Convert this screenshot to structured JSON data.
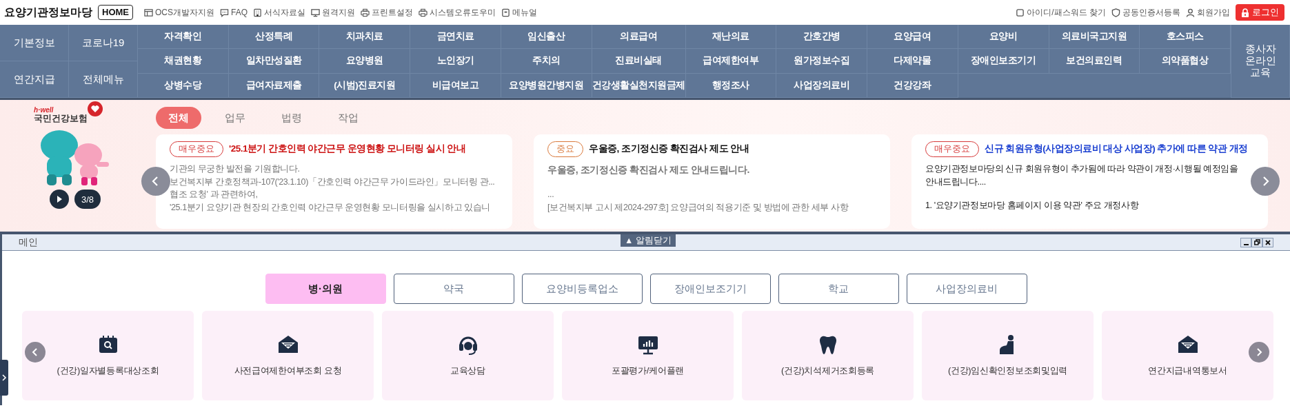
{
  "site": {
    "title": "요양기관정보마당",
    "home": "HOME"
  },
  "top_links": [
    {
      "label": "OCS개발자지원"
    },
    {
      "label": "FAQ"
    },
    {
      "label": "서식자료실"
    },
    {
      "label": "원격지원"
    },
    {
      "label": "프린트설정"
    },
    {
      "label": "시스템오류도우미"
    },
    {
      "label": "메뉴얼"
    }
  ],
  "account_links": [
    {
      "label": "아이디/패스워드 찾기"
    },
    {
      "label": "공동인증서등록"
    },
    {
      "label": "회원가입"
    }
  ],
  "login": "로그인",
  "quick_menu": [
    "기본정보",
    "코로나19",
    "연간지급",
    "전체메뉴"
  ],
  "menu_rows": [
    [
      "자격확인",
      "산정특례",
      "치과치료",
      "금연치료",
      "임신출산",
      "의료급여",
      "재난의료",
      "간호간병",
      "요양급여",
      "요양비",
      "의료비국고지원",
      "호스피스"
    ],
    [
      "채권현황",
      "일차만성질환",
      "요양병원",
      "노인장기",
      "주치의",
      "진료비실태",
      "급여제한여부",
      "원가정보수집",
      "다제약물",
      "장애인보조기기",
      "보건의료인력",
      "의약품협상"
    ],
    [
      "상병수당",
      "급여자료제출",
      "(시범)진료지원",
      "비급여보고",
      "요양병원간병지원",
      "건강생활실천지원금제",
      "행정조사",
      "사업장의료비",
      "건강강좌"
    ]
  ],
  "menu_side": "종사자 온라인 교육",
  "notice": {
    "logo": {
      "tagline": "h·well",
      "name": "국민건강보험"
    },
    "counter": "3/8",
    "tabs": [
      {
        "label": "전체",
        "selected": true
      },
      {
        "label": "업무",
        "selected": false
      },
      {
        "label": "법령",
        "selected": false
      },
      {
        "label": "작업",
        "selected": false
      }
    ],
    "cards": [
      {
        "badge": {
          "text": "매우중요",
          "color": "#d63a3a"
        },
        "title": {
          "text": "'25.1분기 간호인력 야간근무 운영현황 모니터링 실시 안내",
          "color": "#cc1111"
        },
        "lead_bold": false,
        "paragraphs": [
          [
            "기관의 무궁한 발전을 기원합니다.",
            "보건복지부 간호정책과-107('23.1.10)「간호인력 야간근무 가이드라인」모니터링 관...",
            "협조 요청' 과 관련하여,",
            "'25.1분기 요양기관 현장의 간호인력 야간근무 운영현황 모니터링을 실시하고 있습니"
          ]
        ]
      },
      {
        "badge": {
          "text": "중요",
          "color": "#d9783a"
        },
        "title": {
          "text": "우울증, 조기정신증 확진검사 제도 안내",
          "color": "#111111"
        },
        "lead_bold": true,
        "paragraphs": [
          [
            "우울증, 조기정신증 확진검사 제도 안내드립니다."
          ],
          [
            "...",
            "[보건복지부 고시 제2024-297호] 요양급여의 적용기준 및 방법에 관한 세부 사항"
          ]
        ]
      },
      {
        "badge": {
          "text": "매우중요",
          "color": "#d63a3a"
        },
        "title": {
          "text": "신규 회원유형(사업장의료비 대상 사업장) 추가에 따른 약관 개정",
          "color": "#1a3fd1"
        },
        "lead_bold": false,
        "paragraphs": [
          [
            "요양기관정보마당의 신규 회원유형이 추가됨에 따라 약관이 개정·시행될 예정임을",
            "안내드립니다...."
          ],
          [
            "1. '요양기관정보마당 홈페이지 이용 약관' 주요 개정사항"
          ]
        ]
      }
    ]
  },
  "main": {
    "title": "메인",
    "close_alerts": "▲ 알림닫기",
    "categories": [
      {
        "label": "병·의원",
        "selected": true
      },
      {
        "label": "약국",
        "selected": false
      },
      {
        "label": "요양비등록업소",
        "selected": false
      },
      {
        "label": "장애인보조기기",
        "selected": false
      },
      {
        "label": "학교",
        "selected": false
      },
      {
        "label": "사업장의료비",
        "selected": false
      }
    ],
    "tiles": [
      {
        "label": "(건강)일자별등록대상조회"
      },
      {
        "label": "사전급여제한여부조회 요청"
      },
      {
        "label": "교육상담"
      },
      {
        "label": "포괄평가/케어플랜"
      },
      {
        "label": "(건강)치석제거조회등록"
      },
      {
        "label": "(건강)임신확인정보조회및입력"
      },
      {
        "label": "연간지급내역통보서"
      }
    ]
  }
}
